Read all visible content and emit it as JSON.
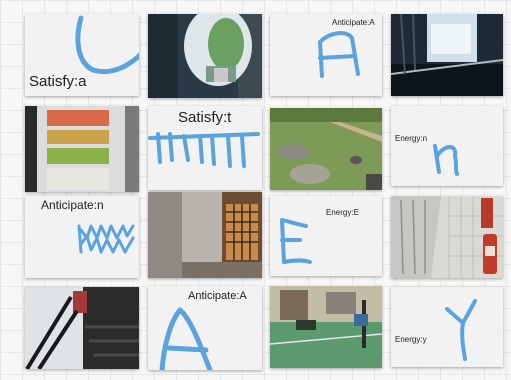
{
  "board": {
    "cards": [
      {
        "label": "Satisfy:a",
        "ink": "U"
      },
      {
        "label": "Anticipate:A",
        "ink": "A"
      },
      {
        "label": "Satisfy:t",
        "ink": "t"
      },
      {
        "label": "Energy:n",
        "ink": "n"
      },
      {
        "label": "Anticipate:n",
        "ink": "n"
      },
      {
        "label": "Energy:E",
        "ink": "E"
      },
      {
        "label": "Anticipate:A",
        "ink": "A"
      },
      {
        "label": "Energy:y",
        "ink": "y"
      }
    ],
    "photos": [
      {
        "subject": "building-arch-with-plants"
      },
      {
        "subject": "stairwell-with-railing"
      },
      {
        "subject": "drink-vending-fridge"
      },
      {
        "subject": "park-with-rocks"
      },
      {
        "subject": "doorway-with-grille"
      },
      {
        "subject": "tiled-wall-fire-extinguisher"
      },
      {
        "subject": "dark-staircase"
      },
      {
        "subject": "sports-court-basketball-hoop"
      }
    ]
  },
  "colors": {
    "ink": "#5aa3de",
    "card": "#f2f2f2",
    "board": "#f7f7f7"
  }
}
